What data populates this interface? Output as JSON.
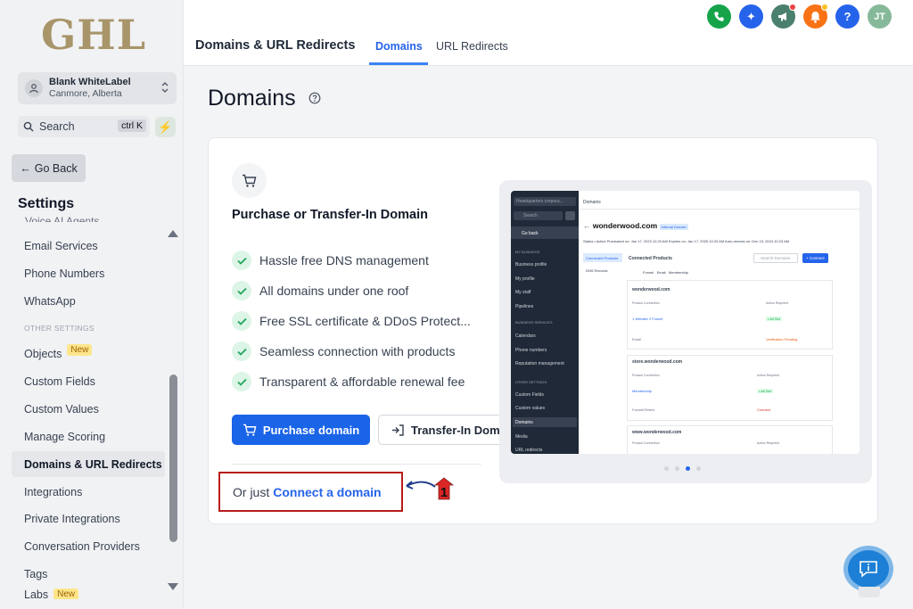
{
  "logo": "GHL",
  "account": {
    "name": "Blank WhiteLabel",
    "location": "Canmore, Alberta"
  },
  "search": {
    "placeholder": "Search",
    "shortcut": "ctrl K"
  },
  "go_back": "Go Back",
  "settings_title": "Settings",
  "nav_cutoff": "Voice AI Agents",
  "nav": {
    "email_services": "Email Services",
    "phone_numbers": "Phone Numbers",
    "whatsapp": "WhatsApp",
    "other_settings": "OTHER SETTINGS",
    "objects": "Objects",
    "new_badge": "New",
    "custom_fields": "Custom Fields",
    "custom_values": "Custom Values",
    "manage_scoring": "Manage Scoring",
    "domains_url": "Domains & URL Redirects",
    "integrations": "Integrations",
    "private_integrations": "Private Integrations",
    "conversation_providers": "Conversation Providers",
    "tags": "Tags",
    "labs": "Labs",
    "labs_badge": "New"
  },
  "header": {
    "title": "Domains & URL Redirects",
    "tabs": {
      "domains": "Domains",
      "url_redirects": "URL Redirects"
    },
    "avatar_initials": "JT",
    "help": "?"
  },
  "page_title": "Domains",
  "card": {
    "heading": "Purchase or Transfer-In Domain",
    "features": [
      "Hassle free DNS management",
      "All domains under one roof",
      "Free SSL certificate & DDoS Protect...",
      "Seamless connection with products",
      "Transparent & affordable renewal fee"
    ],
    "purchase_button": "Purchase domain",
    "transfer_button": "Transfer-In Domain",
    "or_just": "Or just",
    "connect_link": "Connect a domain"
  },
  "annotation_number": "1",
  "preview": {
    "side_header": "Headquarters corpora...",
    "search": "Search",
    "go_back": "Go back",
    "section1": "MY BUSINESS",
    "items1": [
      "Business profile",
      "My profile",
      "My staff",
      "Pipelines"
    ],
    "section2": "BUSINESS SERVICES",
    "items2": [
      "Calendars",
      "Phone numbers",
      "Reputation management"
    ],
    "section3": "OTHER SETTINGS",
    "items3": [
      "Custom Fields",
      "Custom values",
      "Domains",
      "Media",
      "URL redirects"
    ],
    "main_title": "Domains",
    "domain": "wonderwood.com",
    "domain_badge": "Internal Domain",
    "status_line": "Status  • Active   Purchased on: Jan 17, 2023 10:23 AM   Expires on: Jan 17, 2025 10:23 AM   Auto-renews on: Dec 15, 2024 10:23 AM",
    "tab_connected": "Connected Products",
    "tab_dns": "DNS Records",
    "connected_products": "Connected Products",
    "search_domains": "Search Domains",
    "connect_btn": "+ Connect",
    "filters": "Funnel   Email   Membership",
    "box1_title": "wonderwood.com",
    "box2_title": "store.wonderwood.com",
    "box3_title": "www.wonderwood.com",
    "col_product": "Product Connection",
    "col_action": "Action Required",
    "row_website": "1 Website  2 Funnel",
    "row_email": "Email",
    "row_membership": "Membership",
    "row_funnel": "Funnel/Others",
    "all_set": "• All Set",
    "verification": "Verification Pending",
    "connect": "Connect"
  }
}
